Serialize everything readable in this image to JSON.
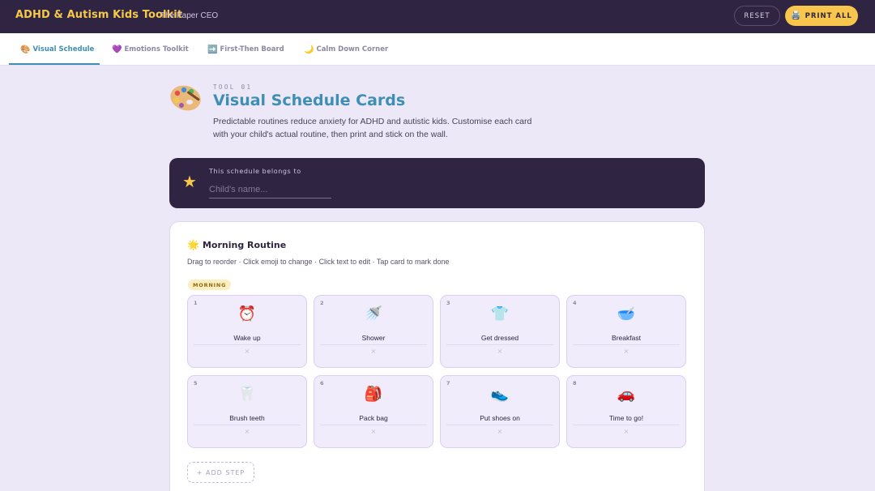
{
  "header": {
    "brand": "ADHD & Autism Kids Toolkit",
    "subtitle": "The Paper CEO",
    "reset_label": "RESET",
    "print_label": "PRINT ALL",
    "print_icon": "printer-icon"
  },
  "tabs": [
    {
      "label": "Visual Schedule",
      "icon": "palette-icon",
      "glyph": "🎨",
      "active": true
    },
    {
      "label": "Emotions Toolkit",
      "icon": "purple-heart-icon",
      "glyph": "💜",
      "active": false
    },
    {
      "label": "First-Then Board",
      "icon": "right-arrow-icon",
      "glyph": "➡️",
      "active": false
    },
    {
      "label": "Calm Down Corner",
      "icon": "crescent-moon-icon",
      "glyph": "🌙",
      "active": false
    }
  ],
  "tool": {
    "kicker": "TOOL 01",
    "title": "Visual Schedule Cards",
    "description": "Predictable routines reduce anxiety for ADHD and autistic kids. Customise each card with your child's actual routine, then print and stick on the wall."
  },
  "owner": {
    "label": "This schedule belongs to",
    "placeholder": "Child's name..."
  },
  "routine": {
    "title": "Morning Routine",
    "hint": "Drag to reorder · Click emoji to change · Click text to edit · Tap card to mark done",
    "tag": "MORNING",
    "steps": [
      {
        "num": "1",
        "emoji": "⏰",
        "label": "Wake up"
      },
      {
        "num": "2",
        "emoji": "🚿",
        "label": "Shower"
      },
      {
        "num": "3",
        "emoji": "👕",
        "label": "Get dressed"
      },
      {
        "num": "4",
        "emoji": "🥣",
        "label": "Breakfast"
      },
      {
        "num": "5",
        "emoji": "🦷",
        "label": "Brush teeth"
      },
      {
        "num": "6",
        "emoji": "🎒",
        "label": "Pack bag"
      },
      {
        "num": "7",
        "emoji": "👟",
        "label": "Put shoes on"
      },
      {
        "num": "8",
        "emoji": "🚗",
        "label": "Time to go!"
      }
    ],
    "remove_glyph": "×",
    "add_label": "+ ADD STEP"
  },
  "colors": {
    "topbar": "#2f2442",
    "brand": "#f6c84a",
    "accent": "#3f8fb5",
    "print_button": "#f8c64d",
    "page_bg": "#ece8f7",
    "card_bg": "#f1ecfb"
  }
}
